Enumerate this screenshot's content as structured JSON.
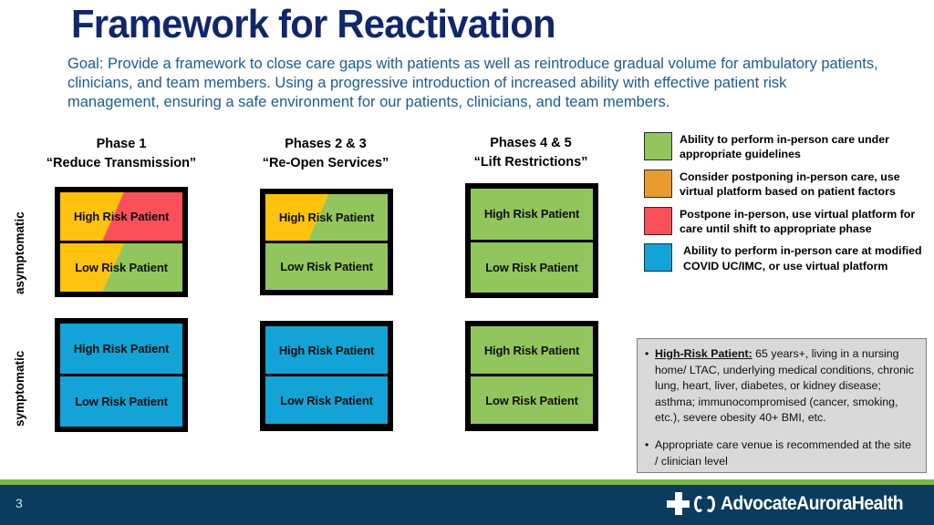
{
  "title": "Framework for Reactivation",
  "goal": "Goal: Provide a framework to close care gaps with patients as well as reintroduce gradual volume for ambulatory patients, clinicians, and team members.  Using a progressive introduction of increased ability with effective patient risk management, ensuring a safe environment for our patients, clinicians, and team members.",
  "colors": {
    "title_navy": "#12276b",
    "goal_blue": "#1f5c8b",
    "green": "#92c55e",
    "orange_legend": "#e89c2e",
    "orange_cell": "#ffc20e",
    "red": "#f9505a",
    "blue": "#14a3d6",
    "footer_navy": "#0b3c5d",
    "footer_green": "#7ab648",
    "infobox_gray": "#d9d9d9"
  },
  "columns": [
    {
      "line1": "Phase 1",
      "line2": "“Reduce Transmission”"
    },
    {
      "line1": "Phases 2 & 3",
      "line2": "“Re-Open Services”"
    },
    {
      "line1": "Phases 4 & 5",
      "line2": "“Lift Restrictions”"
    }
  ],
  "row_labels": {
    "asymptomatic": "asymptomatic",
    "symptomatic": "symptomatic"
  },
  "cell_labels": {
    "high": "High Risk Patient",
    "low": "Low Risk Patient"
  },
  "matrix": {
    "asymptomatic": [
      {
        "high": "orange-to-red-diagonal",
        "low": "orange-to-green-diagonal"
      },
      {
        "high": "orange-to-green-diagonal",
        "low": "green"
      },
      {
        "high": "green",
        "low": "green"
      }
    ],
    "symptomatic": [
      {
        "high": "blue",
        "low": "blue"
      },
      {
        "high": "blue",
        "low": "blue"
      },
      {
        "high": "green",
        "low": "green"
      }
    ]
  },
  "legend": [
    {
      "color": "#92c55e",
      "text": "Ability to perform in-person care under appropriate guidelines"
    },
    {
      "color": "#e89c2e",
      "text": "Consider postponing in-person care, use virtual platform based on patient factors"
    },
    {
      "color": "#f9505a",
      "text": "Postpone in-person, use virtual platform for care until shift to appropriate phase"
    },
    {
      "color": "#14a3d6",
      "text": "Ability to perform in-person care at modified COVID UC/IMC, or use virtual platform"
    }
  ],
  "info_box": {
    "bullet1_label": "High-Risk Patient:",
    "bullet1_text": " 65 years+, living in a nursing home/ LTAC, underlying medical conditions, chronic lung, heart, liver, diabetes, or kidney disease; asthma; immunocompromised (cancer, smoking, etc.), severe obesity 40+ BMI, etc.",
    "bullet2_text": "Appropriate care venue is recommended at the site / clinician level",
    "bullet_char": "•"
  },
  "footer": {
    "page_number": "3",
    "brand": "AdvocateAuroraHealth",
    "tm": "™"
  }
}
